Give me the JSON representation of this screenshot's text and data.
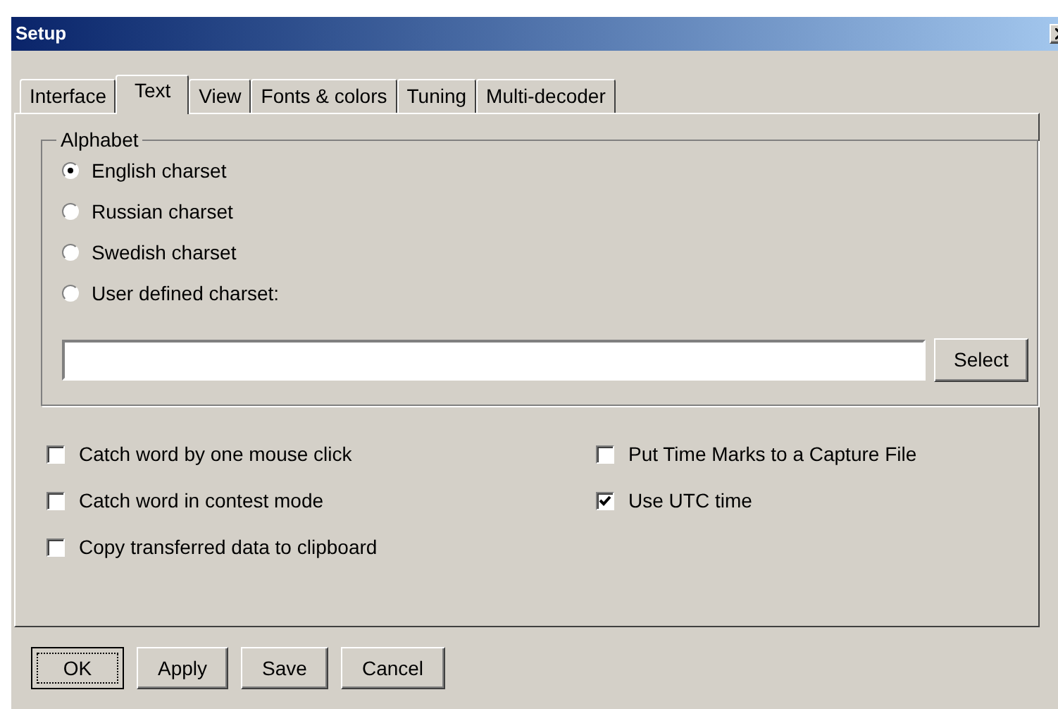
{
  "window": {
    "title": "Setup"
  },
  "tabs": [
    {
      "label": "Interface",
      "selected": false
    },
    {
      "label": "Text",
      "selected": true
    },
    {
      "label": "View",
      "selected": false
    },
    {
      "label": "Fonts & colors",
      "selected": false
    },
    {
      "label": "Tuning",
      "selected": false
    },
    {
      "label": "Multi-decoder",
      "selected": false
    }
  ],
  "alphabet": {
    "legend": "Alphabet",
    "options": [
      {
        "label": "English charset",
        "selected": true
      },
      {
        "label": "Russian charset",
        "selected": false
      },
      {
        "label": "Swedish charset",
        "selected": false
      },
      {
        "label": "User defined charset:",
        "selected": false
      }
    ],
    "select_button": "Select"
  },
  "options_left": [
    {
      "label": "Catch word by one mouse click",
      "checked": false
    },
    {
      "label": "Catch word in contest mode",
      "checked": false
    },
    {
      "label": "Copy transferred data to clipboard",
      "checked": false
    }
  ],
  "options_right": [
    {
      "label": "Put Time Marks to a Capture File",
      "checked": false
    },
    {
      "label": "Use UTC time",
      "checked": true
    }
  ],
  "buttons": [
    {
      "label": "OK",
      "default": true
    },
    {
      "label": "Apply",
      "default": false
    },
    {
      "label": "Save",
      "default": false
    },
    {
      "label": "Cancel",
      "default": false
    }
  ]
}
